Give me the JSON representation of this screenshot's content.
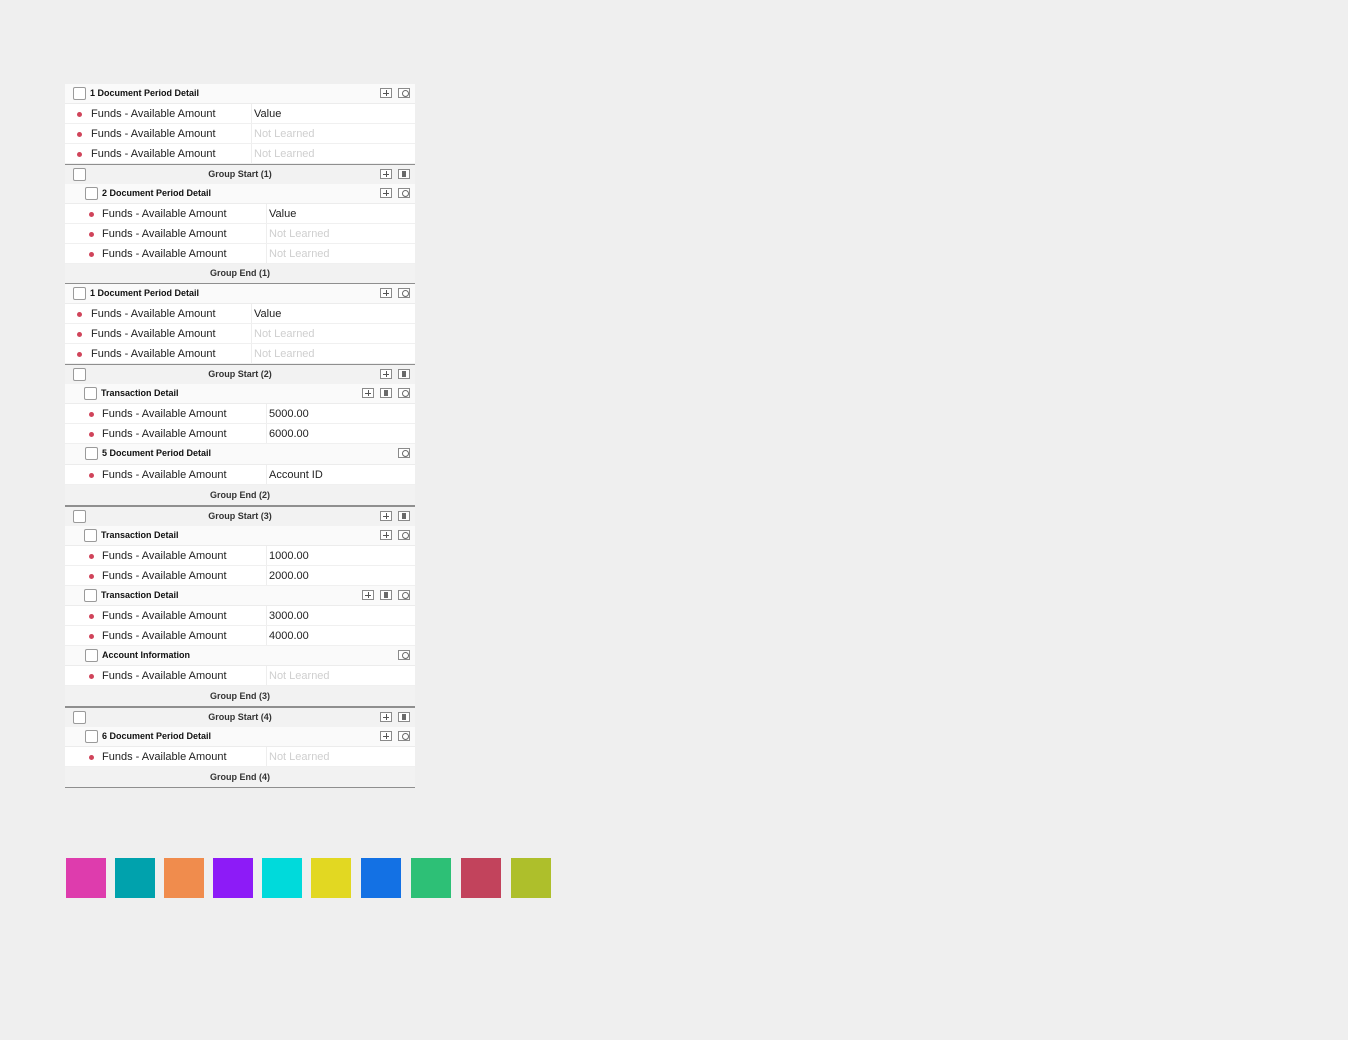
{
  "labels": {
    "funds": "Funds - Available Amount",
    "value": "Value",
    "not_learned": "Not Learned",
    "account_id": "Account ID"
  },
  "sections": {
    "s1": "1 Document Period Detail",
    "s2": "2 Document Period Detail",
    "s3": "1 Document Period Detail",
    "s4": "5 Document Period Detail",
    "s5": "Account Information",
    "s6": "6 Document Period Detail",
    "transaction": "Transaction Detail"
  },
  "groups": [
    {
      "start": "Group Start (1)",
      "end": "Group End (1)",
      "color": "#9b2fd6"
    },
    {
      "start": "Group Start (2)",
      "end": "Group End (2)",
      "color": "#ef8c4c"
    },
    {
      "start": "Group Start (3)",
      "end": "Group End (3)",
      "color": "#009aa6"
    },
    {
      "start": "Group Start (4)",
      "end": "Group End (4)",
      "color": "#de3cad"
    }
  ],
  "amounts": [
    "5000.00",
    "6000.00",
    "1000.00",
    "2000.00",
    "3000.00",
    "4000.00"
  ],
  "icons": {
    "add": "plus-square-icon",
    "delete": "trash-icon",
    "ignore": "block-icon"
  },
  "swatches": [
    "#de3cad",
    "#00a2ad",
    "#f08c4d",
    "#8d1bf7",
    "#00dadb",
    "#e2d822",
    "#1371e4",
    "#2dc076",
    "#c2435c",
    "#aebf2b"
  ]
}
